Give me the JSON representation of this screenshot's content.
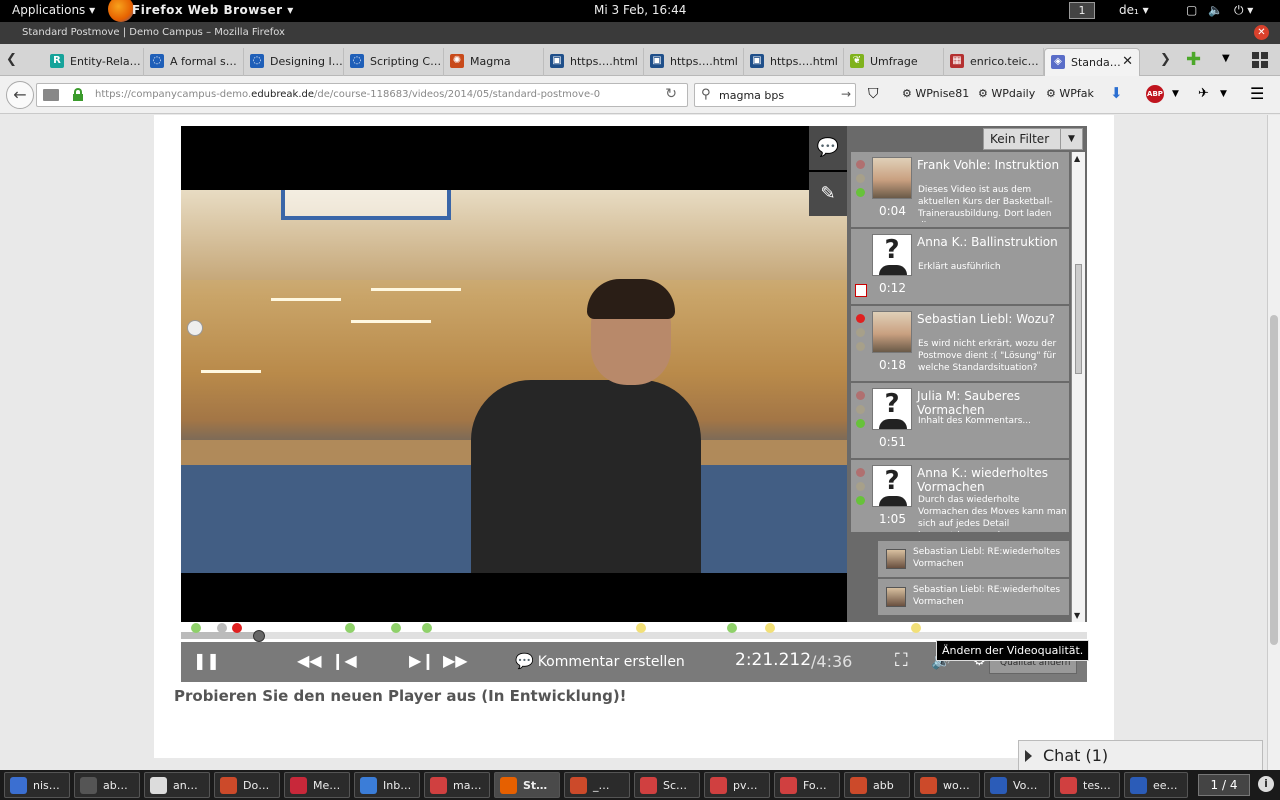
{
  "topbar": {
    "applications": "Applications ▾",
    "browser_name": "Firefox Web Browser ▾",
    "clock": "Mi  3 Feb, 16:44",
    "workspace": "1",
    "lang": "de₁ ▾"
  },
  "window": {
    "title": "Standard Postmove | Demo Campus – Mozilla Firefox"
  },
  "tabs": [
    {
      "label": "Entity-Rela…",
      "icon": "researchgate-icon",
      "color": "#16a39a",
      "glyph": "R"
    },
    {
      "label": "A formal s…",
      "icon": "doi-icon",
      "color": "#1f5fb8",
      "glyph": "◌"
    },
    {
      "label": "Designing I…",
      "icon": "doi-icon",
      "color": "#1f5fb8",
      "glyph": "◌"
    },
    {
      "label": "Scripting C…",
      "icon": "doi-icon",
      "color": "#1f5fb8",
      "glyph": "◌"
    },
    {
      "label": "Magma",
      "icon": "magma-icon",
      "color": "#c84a1a",
      "glyph": "✺"
    },
    {
      "label": "https….html",
      "icon": "page-icon",
      "color": "#1f4f8a",
      "glyph": "▣"
    },
    {
      "label": "https….html",
      "icon": "page-icon",
      "color": "#1f4f8a",
      "glyph": "▣"
    },
    {
      "label": "https….html",
      "icon": "page-icon",
      "color": "#1f4f8a",
      "glyph": "▣"
    },
    {
      "label": "Umfrage",
      "icon": "umfrage-icon",
      "color": "#7fb21c",
      "glyph": "❦"
    },
    {
      "label": "enrico.teic…",
      "icon": "profile-icon",
      "color": "#b43030",
      "glyph": "▦"
    },
    {
      "label": "Standa…",
      "icon": "edubreak-icon",
      "color": "#5a6dc8",
      "glyph": "◈",
      "active": true
    }
  ],
  "nav": {
    "url_prefix": "https://companycampus-demo.",
    "url_domain": "edubreak.de",
    "url_path": "/de/course-118683/videos/2014/05/standard-postmove-0",
    "search_value": "magma bps",
    "bookmarks": [
      "WPnise81",
      "WPdaily",
      "WPfak"
    ],
    "abp": "ABP"
  },
  "player": {
    "filter_label": "Kein Filter",
    "comments": [
      {
        "author_title": "Frank Vohle: Instruktion",
        "time": "0:04",
        "text": "Dieses Video ist aus dem aktuellen Kurs der Basketball-Trainerausbildung. Dort laden die",
        "avatar": "photo",
        "dots": [
          "r-dim",
          "grey",
          "green"
        ]
      },
      {
        "author_title": "Anna K.: Ballinstruktion",
        "time": "0:12",
        "text": "Erklärt ausführlich",
        "avatar": "unknown",
        "dots": [],
        "flag": true
      },
      {
        "author_title": "Sebastian Liebl: Wozu?",
        "time": "0:18",
        "text": "Es wird nicht erkrärt, wozu der Postmove dient :( \"Lösung\" für welche Standardsituation?",
        "avatar": "photo",
        "dots": [
          "red",
          "grey",
          "grey"
        ]
      },
      {
        "author_title": "Julia M: Sauberes Vormachen",
        "time": "0:51",
        "text": "Inhalt des Kommentars...",
        "avatar": "unknown",
        "dots": [
          "r-dim",
          "grey",
          "green"
        ]
      },
      {
        "author_title": "Anna K.: wiederholtes Vormachen",
        "time": "1:05",
        "text": "Durch das wiederholte Vormachen des Moves kann man sich auf jedes Detail konzentrieren und",
        "avatar": "unknown",
        "dots": [
          "r-dim",
          "grey",
          "green"
        ]
      }
    ],
    "replies": [
      "Sebastian Liebl: RE:wiederholtes Vormachen",
      "Sebastian Liebl: RE:wiederholtes Vormachen"
    ],
    "markers": [
      {
        "pos": 0.017,
        "color": "#8fd16a"
      },
      {
        "pos": 0.045,
        "color": "#bbbbbb"
      },
      {
        "pos": 0.062,
        "color": "#e02020"
      },
      {
        "pos": 0.186,
        "color": "#8fd16a"
      },
      {
        "pos": 0.237,
        "color": "#8fd16a"
      },
      {
        "pos": 0.272,
        "color": "#8fd16a"
      },
      {
        "pos": 0.508,
        "color": "#f2e078"
      },
      {
        "pos": 0.608,
        "color": "#8fd16a"
      },
      {
        "pos": 0.65,
        "color": "#f2e078"
      },
      {
        "pos": 0.811,
        "color": "#f2e078"
      }
    ],
    "progress": 0.086,
    "comment_button": "Kommentar erstellen",
    "current_time": "2:21.212",
    "total_time": "/4:36",
    "quality_label": "Qualität ändern",
    "tooltip": "Ändern der Videoqualität."
  },
  "promo": "Probieren Sie den neuen Player aus (In Entwicklung)!",
  "chat": "Chat (1)",
  "taskbar": [
    {
      "label": "nis…",
      "color": "#3b6fd1",
      "active": false
    },
    {
      "label": "ab…",
      "color": "#555555",
      "active": false
    },
    {
      "label": "an…",
      "color": "#dcdcdc",
      "active": false
    },
    {
      "label": "Do…",
      "color": "#cc4a2a",
      "active": false
    },
    {
      "label": "Me…",
      "color": "#c8283a",
      "active": false
    },
    {
      "label": "Inb…",
      "color": "#3b7dd8",
      "active": false
    },
    {
      "label": "ma…",
      "color": "#d04040",
      "active": false
    },
    {
      "label": "St…",
      "color": "#e66000",
      "active": true
    },
    {
      "label": "_…",
      "color": "#cc4a2a",
      "active": false
    },
    {
      "label": "Sc…",
      "color": "#d04040",
      "active": false
    },
    {
      "label": "pv…",
      "color": "#d04040",
      "active": false
    },
    {
      "label": "Fo…",
      "color": "#d04040",
      "active": false
    },
    {
      "label": "abb",
      "color": "#cc4a2a",
      "active": false
    },
    {
      "label": "wo…",
      "color": "#cc4a2a",
      "active": false
    },
    {
      "label": "Vo…",
      "color": "#2b5cb8",
      "active": false
    },
    {
      "label": "tes…",
      "color": "#d04040",
      "active": false
    },
    {
      "label": "ee…",
      "color": "#2b5cb8",
      "active": false
    }
  ],
  "pager": "1 / 4"
}
